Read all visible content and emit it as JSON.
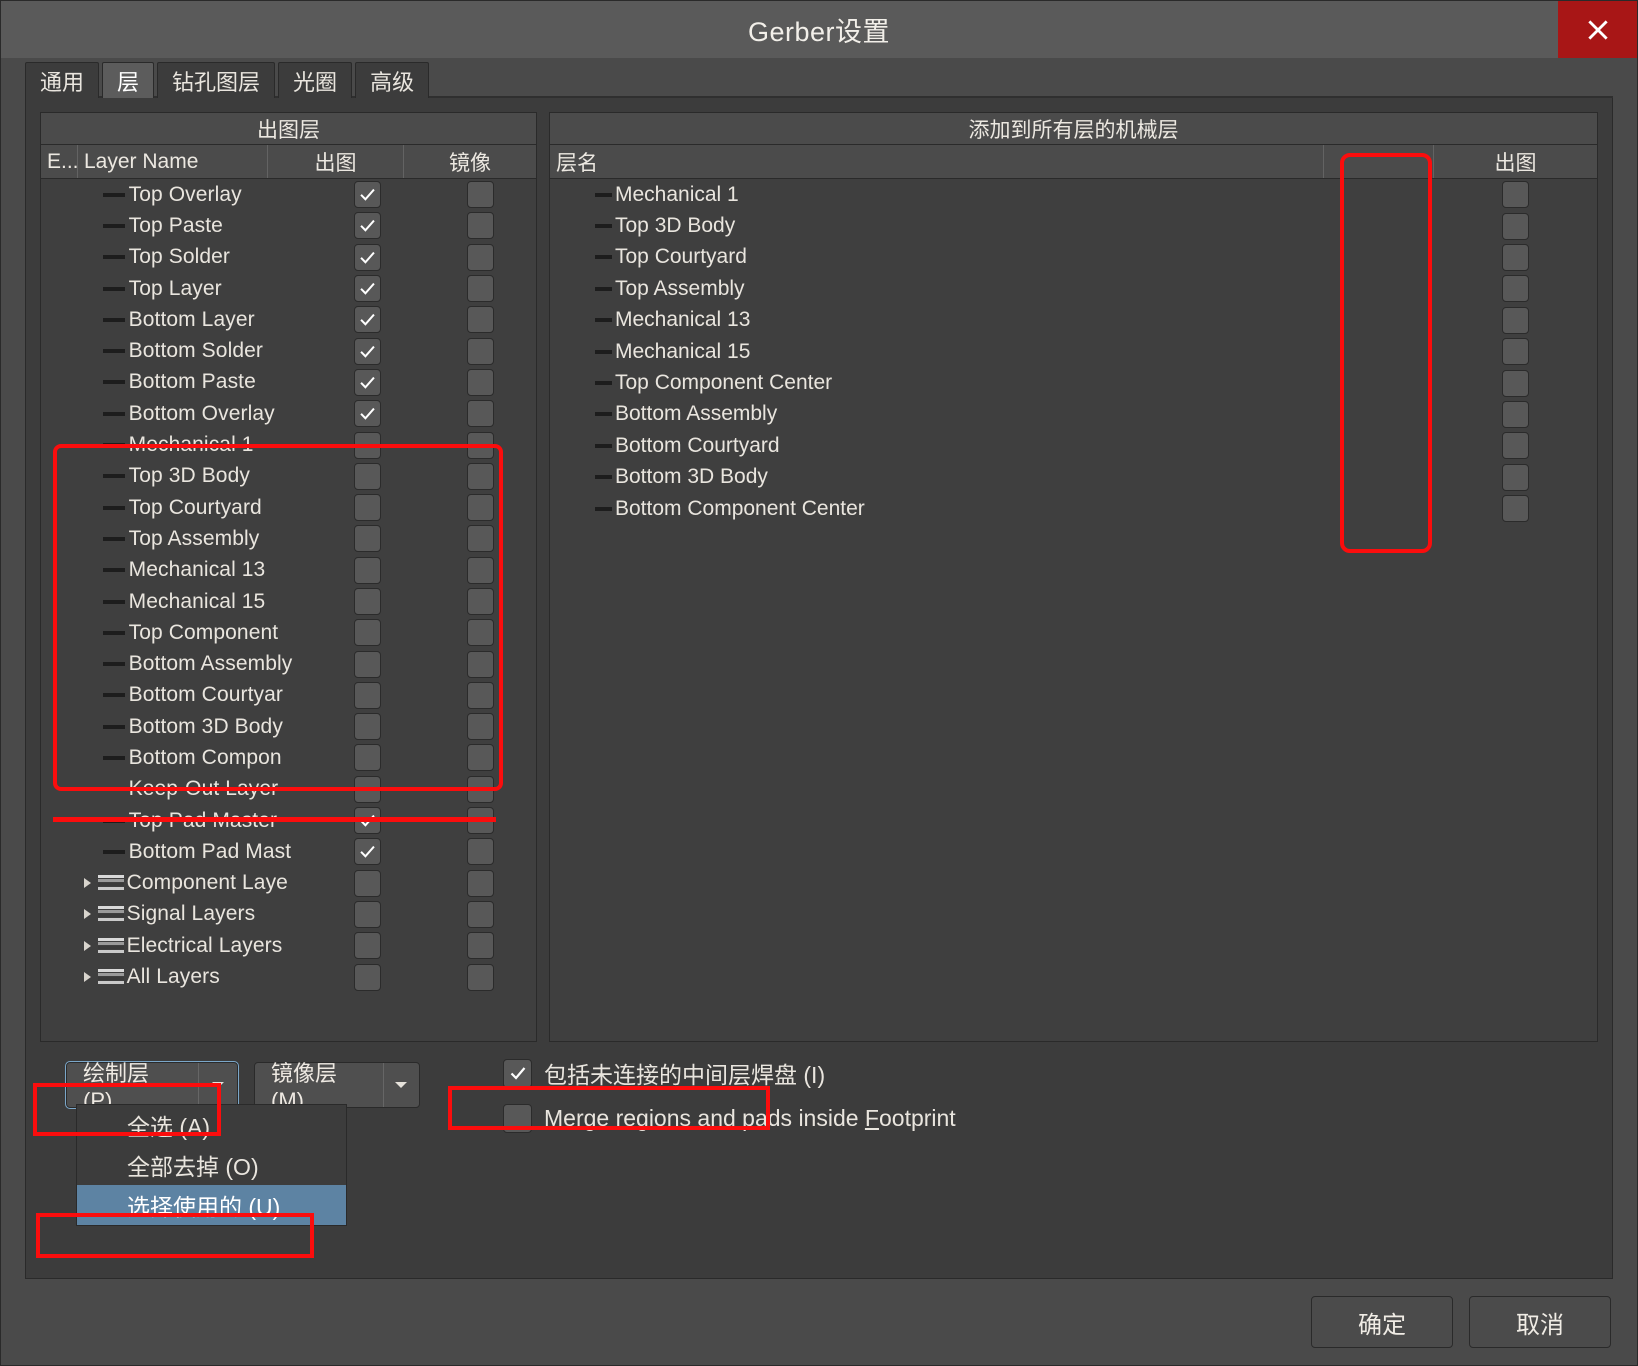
{
  "window": {
    "title": "Gerber设置",
    "close_icon": "close-icon"
  },
  "tabs": [
    {
      "label": "通用",
      "active": false
    },
    {
      "label": "层",
      "active": true
    },
    {
      "label": "钻孔图层",
      "active": false
    },
    {
      "label": "光圈",
      "active": false
    },
    {
      "label": "高级",
      "active": false
    }
  ],
  "left_pane": {
    "title": "出图层",
    "columns": {
      "extra": "E...",
      "name": "Layer Name",
      "plot": "出图",
      "mirror": "镜像"
    },
    "rows": [
      {
        "name": "Top Overlay",
        "plot": true,
        "mirror": false,
        "kind": "layer"
      },
      {
        "name": "Top Paste",
        "plot": true,
        "mirror": false,
        "kind": "layer"
      },
      {
        "name": "Top Solder",
        "plot": true,
        "mirror": false,
        "kind": "layer"
      },
      {
        "name": "Top Layer",
        "plot": true,
        "mirror": false,
        "kind": "layer"
      },
      {
        "name": "Bottom Layer",
        "plot": true,
        "mirror": false,
        "kind": "layer"
      },
      {
        "name": "Bottom Solder",
        "plot": true,
        "mirror": false,
        "kind": "layer"
      },
      {
        "name": "Bottom Paste",
        "plot": true,
        "mirror": false,
        "kind": "layer"
      },
      {
        "name": "Bottom Overlay",
        "plot": true,
        "mirror": false,
        "kind": "layer"
      },
      {
        "name": "Mechanical 1",
        "plot": false,
        "mirror": false,
        "kind": "layer"
      },
      {
        "name": "Top 3D Body",
        "plot": false,
        "mirror": false,
        "kind": "layer"
      },
      {
        "name": "Top Courtyard",
        "plot": false,
        "mirror": false,
        "kind": "layer"
      },
      {
        "name": "Top Assembly",
        "plot": false,
        "mirror": false,
        "kind": "layer"
      },
      {
        "name": "Mechanical 13",
        "plot": false,
        "mirror": false,
        "kind": "layer"
      },
      {
        "name": "Mechanical 15",
        "plot": false,
        "mirror": false,
        "kind": "layer"
      },
      {
        "name": "Top Component",
        "plot": false,
        "mirror": false,
        "kind": "layer"
      },
      {
        "name": "Bottom Assembly",
        "plot": false,
        "mirror": false,
        "kind": "layer"
      },
      {
        "name": "Bottom Courtyar",
        "plot": false,
        "mirror": false,
        "kind": "layer"
      },
      {
        "name": "Bottom 3D Body",
        "plot": false,
        "mirror": false,
        "kind": "layer"
      },
      {
        "name": "Bottom Compon",
        "plot": false,
        "mirror": false,
        "kind": "layer"
      },
      {
        "name": "Keep-Out Layer",
        "plot": false,
        "mirror": false,
        "kind": "layer"
      },
      {
        "name": "Top Pad Master",
        "plot": true,
        "mirror": false,
        "kind": "layer"
      },
      {
        "name": "Bottom Pad Mast",
        "plot": true,
        "mirror": false,
        "kind": "layer"
      },
      {
        "name": "Component Laye",
        "plot": false,
        "mirror": false,
        "kind": "group"
      },
      {
        "name": "Signal Layers",
        "plot": false,
        "mirror": false,
        "kind": "group"
      },
      {
        "name": "Electrical Layers",
        "plot": false,
        "mirror": false,
        "kind": "group"
      },
      {
        "name": "All Layers",
        "plot": false,
        "mirror": false,
        "kind": "group"
      }
    ]
  },
  "right_pane": {
    "title": "添加到所有层的机械层",
    "columns": {
      "name": "层名",
      "plot": "出图"
    },
    "rows": [
      {
        "name": "Mechanical 1",
        "plot": false
      },
      {
        "name": "Top 3D Body",
        "plot": false
      },
      {
        "name": "Top Courtyard",
        "plot": false
      },
      {
        "name": "Top Assembly",
        "plot": false
      },
      {
        "name": "Mechanical 13",
        "plot": false
      },
      {
        "name": "Mechanical 15",
        "plot": false
      },
      {
        "name": "Top Component Center",
        "plot": false
      },
      {
        "name": "Bottom Assembly",
        "plot": false
      },
      {
        "name": "Bottom Courtyard",
        "plot": false
      },
      {
        "name": "Bottom 3D Body",
        "plot": false
      },
      {
        "name": "Bottom Component Center",
        "plot": false
      }
    ]
  },
  "controls": {
    "plot_layers_label": "绘制层 (P)",
    "mirror_layers_label": "镜像层 (M)",
    "menu": {
      "items": [
        {
          "label": "全选 (A)",
          "selected": false
        },
        {
          "label": "全部去掉 (O)",
          "selected": false
        },
        {
          "label": "选择使用的 (U)",
          "selected": true
        }
      ]
    },
    "checkbox_include": {
      "label": "包括未连接的中间层焊盘 (I)",
      "checked": true
    },
    "checkbox_merge": {
      "label": "Merge regions and pads inside Footprint",
      "checked": false
    }
  },
  "footer": {
    "ok_label": "确定",
    "cancel_label": "取消"
  },
  "colors": {
    "accent_red": "#fb0d0d",
    "close_red": "#a81616",
    "selection_blue": "#5d83a3",
    "window_bg": "#4a4a4a",
    "pane_bg": "#3f3f3f"
  }
}
